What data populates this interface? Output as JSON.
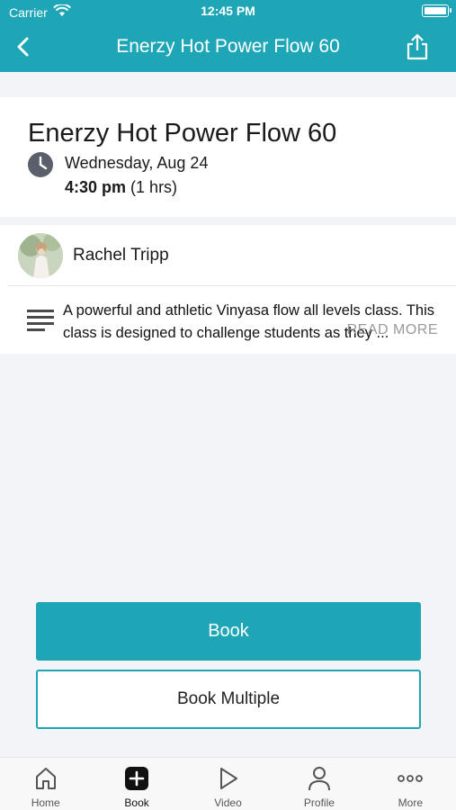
{
  "status_bar": {
    "carrier": "Carrier",
    "time": "12:45 PM"
  },
  "nav": {
    "title": "Enerzy Hot Power Flow 60",
    "back_icon": "chevron-left-icon",
    "share_icon": "share-icon"
  },
  "class": {
    "title": "Enerzy Hot Power Flow 60",
    "date": "Wednesday, Aug 24",
    "time": "4:30 pm",
    "duration": "(1 hrs)"
  },
  "instructor": {
    "name": "Rachel Tripp"
  },
  "description": {
    "text": "A powerful and athletic Vinyasa flow all levels class. This class is designed to challenge students as they ...",
    "read_more": "READ MORE"
  },
  "actions": {
    "book": "Book",
    "book_multiple": "Book Multiple"
  },
  "colors": {
    "accent": "#1ea6b6"
  },
  "tabs": [
    {
      "label": "Home",
      "icon": "home-icon"
    },
    {
      "label": "Book",
      "icon": "plus-square-icon",
      "active": true
    },
    {
      "label": "Video",
      "icon": "play-icon"
    },
    {
      "label": "Profile",
      "icon": "user-icon"
    },
    {
      "label": "More",
      "icon": "more-icon"
    }
  ]
}
